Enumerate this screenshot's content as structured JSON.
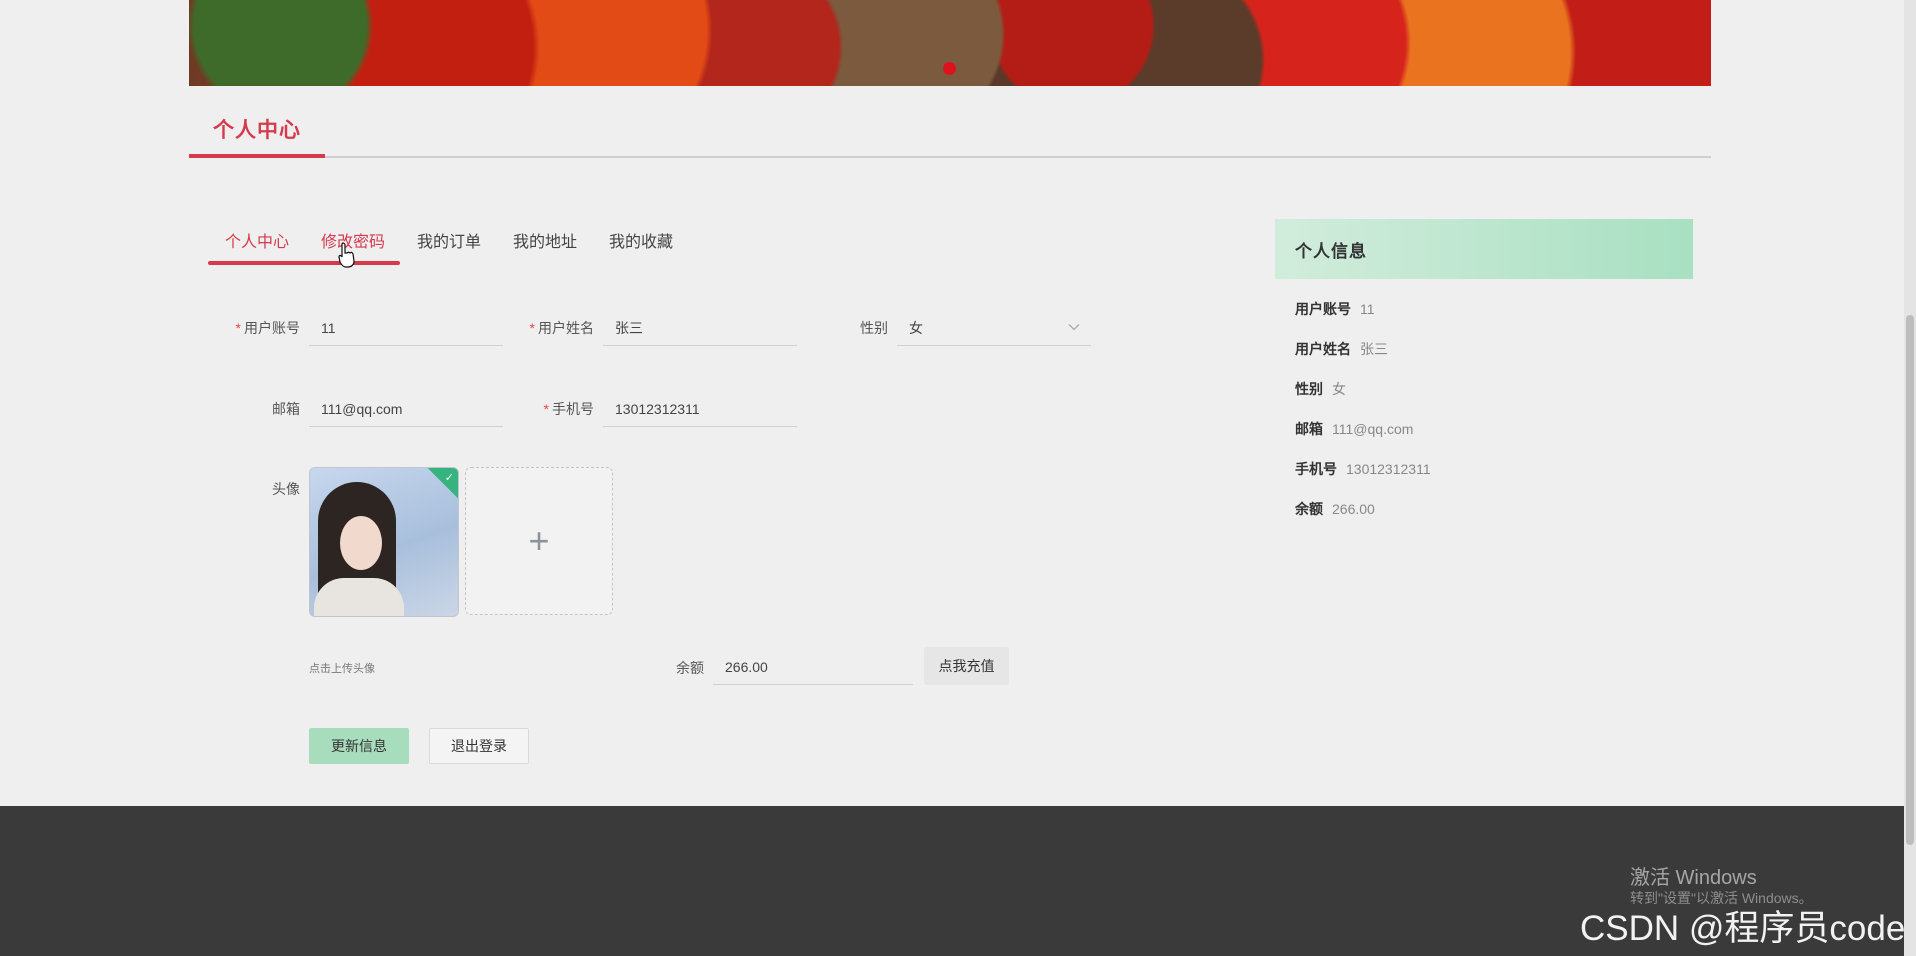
{
  "banner": {
    "active_slide": 1
  },
  "section": {
    "title": "个人中心"
  },
  "tabs": [
    {
      "label": "个人中心"
    },
    {
      "label": "修改密码"
    },
    {
      "label": "我的订单"
    },
    {
      "label": "我的地址"
    },
    {
      "label": "我的收藏"
    }
  ],
  "form": {
    "account": {
      "label": "用户账号",
      "value": "11",
      "required": true
    },
    "name": {
      "label": "用户姓名",
      "value": "张三",
      "required": true
    },
    "gender": {
      "label": "性别",
      "value": "女"
    },
    "email": {
      "label": "邮箱",
      "value": "111@qq.com"
    },
    "phone": {
      "label": "手机号",
      "value": "13012312311",
      "required": true
    },
    "avatar": {
      "label": "头像",
      "hint": "点击上传头像"
    },
    "balance": {
      "label": "余额",
      "value": "266.00"
    },
    "recharge_label": "点我充值",
    "update_label": "更新信息",
    "logout_label": "退出登录"
  },
  "info_panel": {
    "title": "个人信息",
    "rows": [
      {
        "key": "用户账号",
        "value": "11"
      },
      {
        "key": "用户姓名",
        "value": "张三"
      },
      {
        "key": "性别",
        "value": "女"
      },
      {
        "key": "邮箱",
        "value": "111@qq.com"
      },
      {
        "key": "手机号",
        "value": "13012312311"
      },
      {
        "key": "余额",
        "value": "266.00"
      }
    ]
  },
  "watermark": {
    "activate_title": "激活 Windows",
    "activate_sub": "转到\"设置\"以激活 Windows。",
    "csdn": "CSDN @程序员code"
  },
  "colors": {
    "accent": "#d63a4d",
    "success_green": "#a7dcbc",
    "footer_bg": "#3a3a3a"
  },
  "icons": [
    "chevron-down-icon",
    "plus-icon",
    "check-icon",
    "pointer-cursor-icon"
  ]
}
